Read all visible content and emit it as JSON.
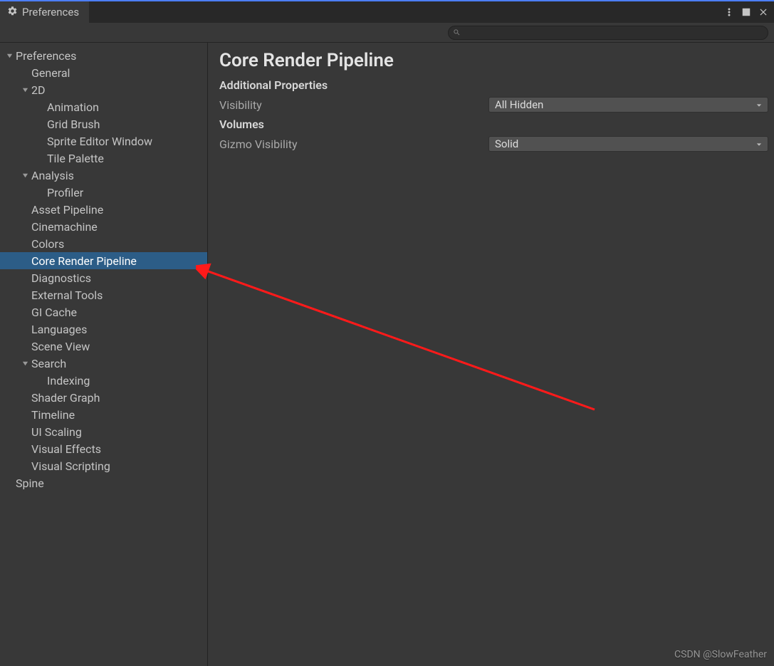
{
  "window": {
    "tab_title": "Preferences"
  },
  "search": {
    "placeholder": ""
  },
  "sidebar": {
    "tree": [
      {
        "label": "Preferences",
        "depth": 0,
        "arrow": "down"
      },
      {
        "label": "General",
        "depth": 1,
        "arrow": ""
      },
      {
        "label": "2D",
        "depth": 1,
        "arrow": "down"
      },
      {
        "label": "Animation",
        "depth": 2,
        "arrow": ""
      },
      {
        "label": "Grid Brush",
        "depth": 2,
        "arrow": ""
      },
      {
        "label": "Sprite Editor Window",
        "depth": 2,
        "arrow": ""
      },
      {
        "label": "Tile Palette",
        "depth": 2,
        "arrow": ""
      },
      {
        "label": "Analysis",
        "depth": 1,
        "arrow": "down"
      },
      {
        "label": "Profiler",
        "depth": 2,
        "arrow": ""
      },
      {
        "label": "Asset Pipeline",
        "depth": 1,
        "arrow": ""
      },
      {
        "label": "Cinemachine",
        "depth": 1,
        "arrow": ""
      },
      {
        "label": "Colors",
        "depth": 1,
        "arrow": ""
      },
      {
        "label": "Core Render Pipeline",
        "depth": 1,
        "arrow": "",
        "selected": true
      },
      {
        "label": "Diagnostics",
        "depth": 1,
        "arrow": ""
      },
      {
        "label": "External Tools",
        "depth": 1,
        "arrow": ""
      },
      {
        "label": "GI Cache",
        "depth": 1,
        "arrow": ""
      },
      {
        "label": "Languages",
        "depth": 1,
        "arrow": ""
      },
      {
        "label": "Scene View",
        "depth": 1,
        "arrow": ""
      },
      {
        "label": "Search",
        "depth": 1,
        "arrow": "down"
      },
      {
        "label": "Indexing",
        "depth": 2,
        "arrow": ""
      },
      {
        "label": "Shader Graph",
        "depth": 1,
        "arrow": ""
      },
      {
        "label": "Timeline",
        "depth": 1,
        "arrow": ""
      },
      {
        "label": "UI Scaling",
        "depth": 1,
        "arrow": ""
      },
      {
        "label": "Visual Effects",
        "depth": 1,
        "arrow": ""
      },
      {
        "label": "Visual Scripting",
        "depth": 1,
        "arrow": ""
      },
      {
        "label": "Spine",
        "depth": 0,
        "arrow": ""
      }
    ]
  },
  "content": {
    "title": "Core Render Pipeline",
    "sections": [
      {
        "header": "Additional Properties",
        "rows": [
          {
            "label": "Visibility",
            "value": "All Hidden"
          }
        ]
      },
      {
        "header": "Volumes",
        "rows": [
          {
            "label": "Gizmo Visibility",
            "value": "Solid"
          }
        ]
      }
    ]
  },
  "watermark": "CSDN @SlowFeather"
}
